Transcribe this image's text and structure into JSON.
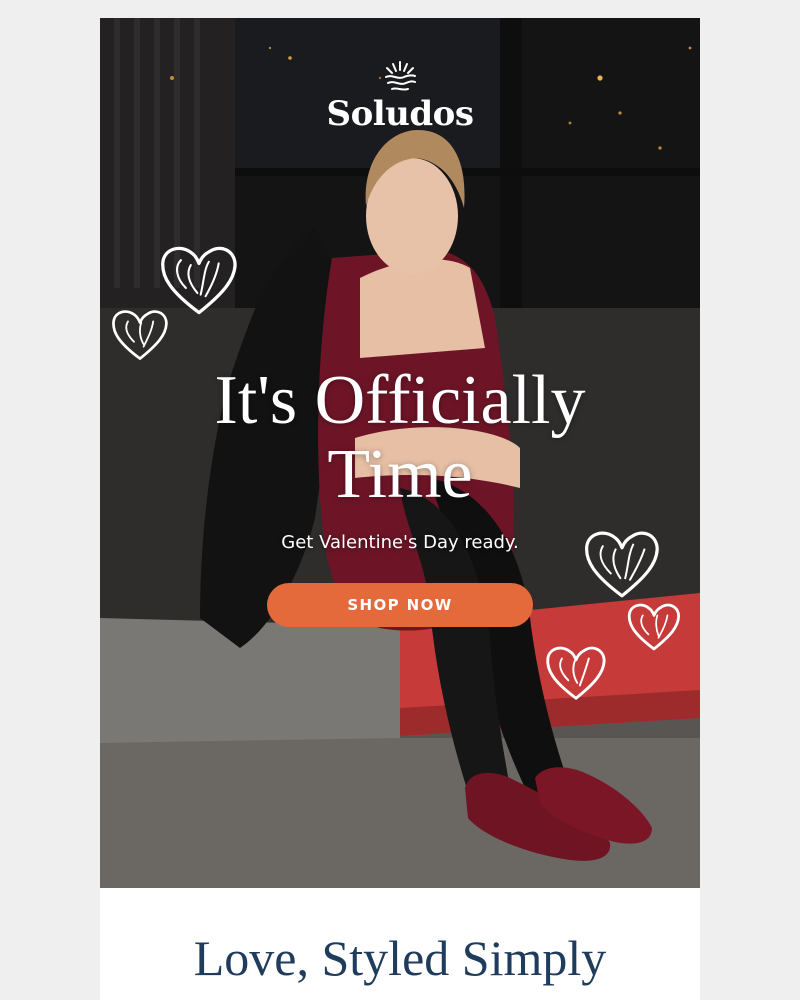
{
  "brand": {
    "name": "Soludos",
    "logo_icon": "sun-waves-icon"
  },
  "hero": {
    "headline_line1": "It's Officially",
    "headline_line2": "Time",
    "subheadline": "Get Valentine's Day ready.",
    "cta_label": "SHOP NOW",
    "decor_icons": [
      "heart-icon",
      "heart-icon",
      "heart-icon",
      "heart-icon",
      "heart-icon"
    ]
  },
  "section": {
    "title": "Love, Styled Simply"
  },
  "colors": {
    "page_background": "#efefef",
    "cta_background": "#e46a3b",
    "cta_text": "#ffffff",
    "section_title": "#1f3c5c",
    "hero_text": "#ffffff"
  }
}
